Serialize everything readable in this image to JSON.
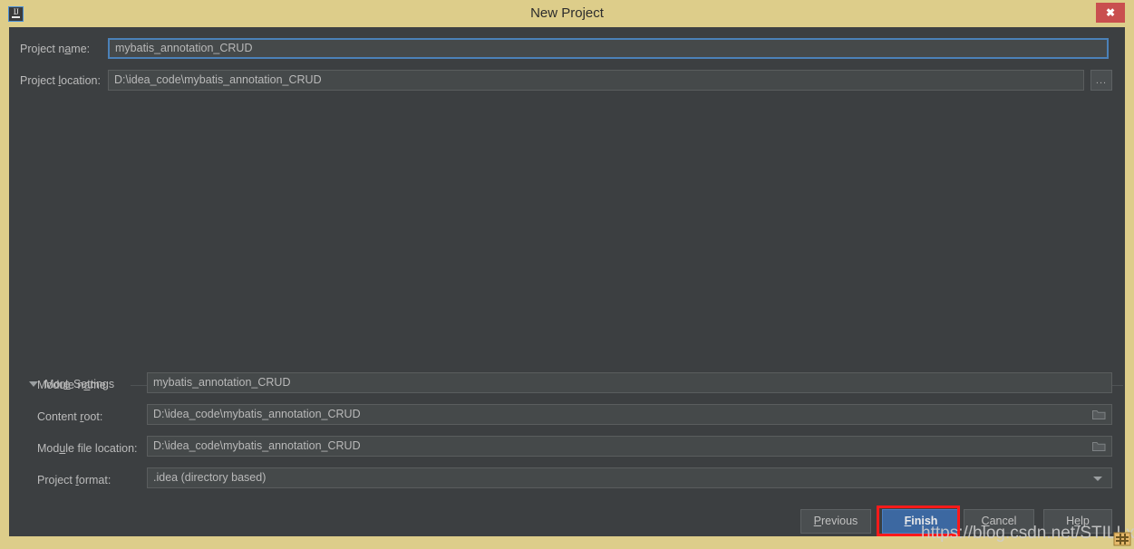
{
  "window": {
    "title": "New Project",
    "app_icon": "intellij-idea-icon",
    "icon_letters": "IJ",
    "close_label": "✖",
    "border_color": "#ddcd8a",
    "body_color": "#3c3f41"
  },
  "top_form": {
    "project_name": {
      "label_pre": "Project n",
      "label_mnemonic": "a",
      "label_post": "me:",
      "label_full": "Project name:",
      "value": "mybatis_annotation_CRUD",
      "focused": true
    },
    "project_location": {
      "label_pre": "Project ",
      "label_mnemonic": "l",
      "label_post": "ocation:",
      "label_full": "Project location:",
      "value": "D:\\idea_code\\mybatis_annotation_CRUD",
      "browse_label": "...",
      "browse_icon": "ellipsis-icon"
    }
  },
  "more_settings": {
    "label_pre": "Mor",
    "label_mnemonic": "e",
    "label_post": " Settings",
    "label_full": "More Settings",
    "expanded": true,
    "collapse_icon": "chevron-down-icon",
    "rows": [
      {
        "label_pre": "Module n",
        "label_mnemonic": "a",
        "label_post": "me:",
        "label_full": "Module name:",
        "value": "mybatis_annotation_CRUD",
        "trailing_icon": ""
      },
      {
        "label_pre": "Content ",
        "label_mnemonic": "r",
        "label_post": "oot:",
        "label_full": "Content root:",
        "value": "D:\\idea_code\\mybatis_annotation_CRUD",
        "trailing_icon": "folder-icon"
      },
      {
        "label_pre": "Mod",
        "label_mnemonic": "u",
        "label_post": "le file location:",
        "label_full": "Module file location:",
        "value": "D:\\idea_code\\mybatis_annotation_CRUD",
        "trailing_icon": "folder-icon"
      },
      {
        "label_pre": "Project ",
        "label_mnemonic": "f",
        "label_post": "ormat:",
        "label_full": "Project format:",
        "value": ".idea (directory based)",
        "trailing_icon": "chevron-down-icon",
        "options": [
          ".idea (directory based)"
        ]
      }
    ]
  },
  "buttons": {
    "previous": {
      "pre": "",
      "mnemonic": "P",
      "post": "revious",
      "full": "Previous"
    },
    "finish": {
      "pre": "",
      "mnemonic": "F",
      "post": "inish",
      "full": "Finish",
      "primary": true,
      "highlighted": true
    },
    "cancel": {
      "pre": "",
      "mnemonic": "C",
      "post": "ancel",
      "full": "Cancel"
    },
    "help": {
      "pre": "H",
      "mnemonic": "e",
      "post": "lp",
      "full": "Help"
    }
  },
  "annotation": {
    "highlight_color": "#ff1a1a",
    "primary_color": "#3c68a1",
    "focus_color": "#4b81b8"
  },
  "watermark": {
    "text": "https://blog.csdn.net/STILLxjy"
  }
}
